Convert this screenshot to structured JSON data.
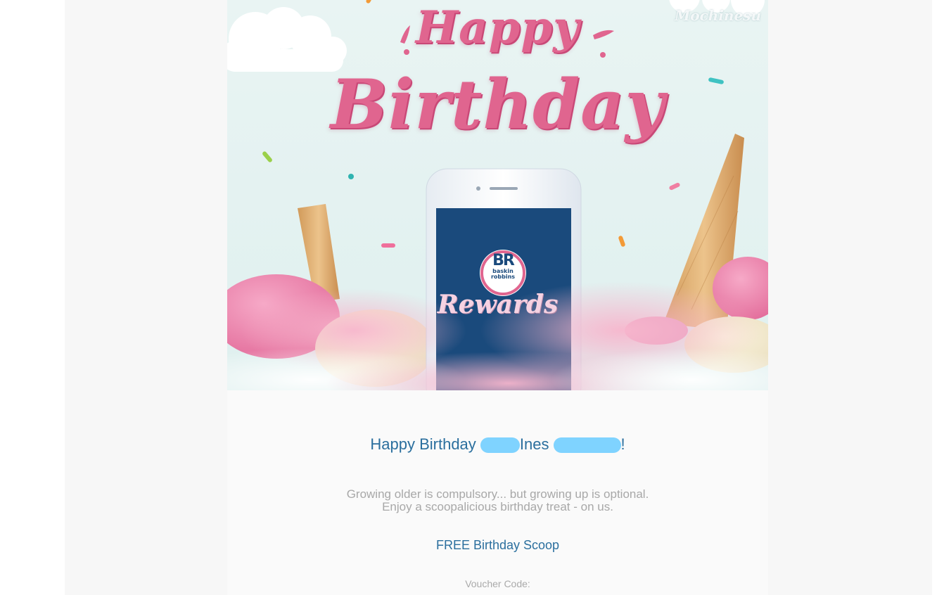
{
  "hero": {
    "watermark": "Mochinesu",
    "headline_line1": "Happy",
    "headline_line2": "Birthday",
    "logo_monogram": "BR",
    "logo_text_1": "baskin",
    "logo_text_2": "robbins",
    "app_name": "Rewards"
  },
  "greeting": {
    "prefix": "Happy Birthday ",
    "name": "Ines",
    "suffix": "!"
  },
  "body": {
    "line1": "Growing older is compulsory... but growing up is optional.",
    "line2": "Enjoy a scoopalicious birthday treat - on us."
  },
  "offer": {
    "title": "FREE Birthday Scoop"
  },
  "voucher": {
    "label": "Voucher Code:"
  },
  "colors": {
    "page_bg": "#f7f7f7",
    "email_bg": "#fafafa",
    "brand_pink": "#e0658f",
    "brand_blue": "#1a4a7c",
    "link_blue": "#2b6f9e",
    "muted_gray": "#a8a8a8",
    "redaction_blue": "#7fd3ff"
  }
}
